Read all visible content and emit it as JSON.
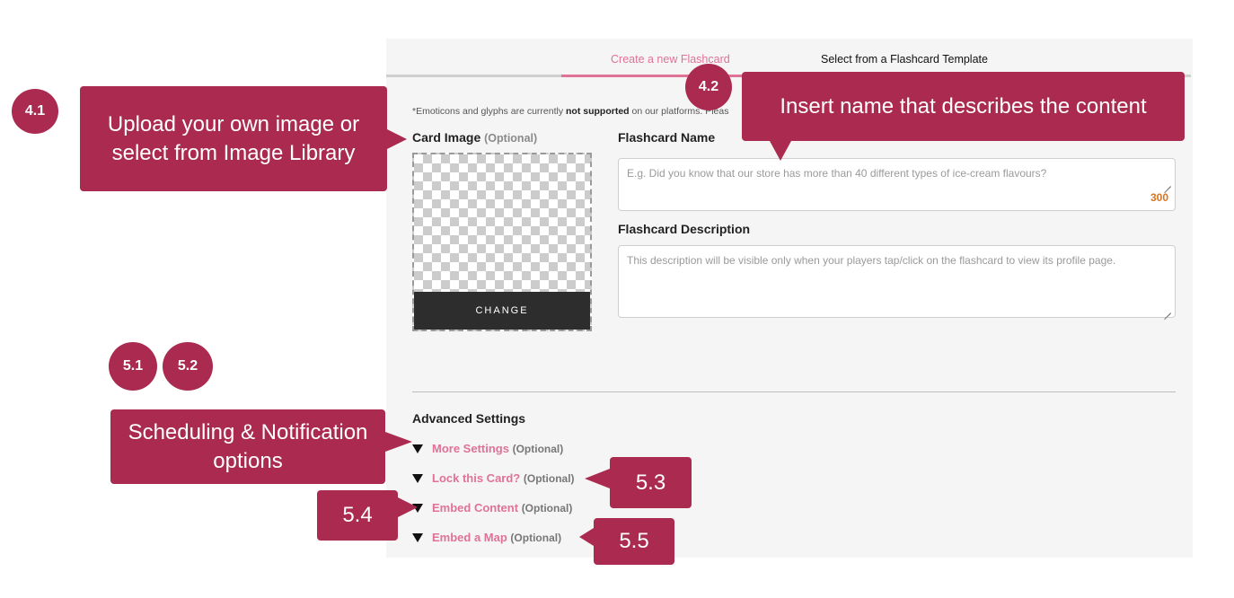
{
  "tabs": {
    "create": "Create a new Flashcard",
    "template": "Select from a Flashcard Template"
  },
  "notice": {
    "pre": "*Emoticons and glyphs are currently ",
    "bold": "not supported",
    "post": " on our platforms. Pleas"
  },
  "card_image": {
    "label": "Card Image",
    "optional": "(Optional)",
    "change": "CHANGE"
  },
  "flashcard_name": {
    "label": "Flashcard Name",
    "placeholder": "E.g. Did you know that our store has more than 40 different types of ice-cream flavours?",
    "counter": "300"
  },
  "flashcard_description": {
    "label": "Flashcard Description",
    "placeholder": "This description will be visible only when your players tap/click on the flashcard to view its profile page."
  },
  "advanced": {
    "title": "Advanced Settings",
    "items": [
      {
        "label": "More Settings",
        "optional": "(Optional)"
      },
      {
        "label": "Lock this Card?",
        "optional": "(Optional)"
      },
      {
        "label": "Embed Content",
        "optional": "(Optional)"
      },
      {
        "label": "Embed a Map",
        "optional": "(Optional)"
      }
    ]
  },
  "annotations": {
    "upload_callout": "Upload your own image or select from Image Library",
    "name_callout": "Insert name that describes the content",
    "scheduling_callout": "Scheduling & Notification options",
    "badges": {
      "b41": "4.1",
      "b42": "4.2",
      "b51": "5.1",
      "b52": "5.2",
      "b53": "5.3",
      "b54": "5.4",
      "b55": "5.5"
    }
  },
  "colors": {
    "accent_pink": "#e07296",
    "annotation": "#aa2a50",
    "counter": "#d9731f"
  }
}
